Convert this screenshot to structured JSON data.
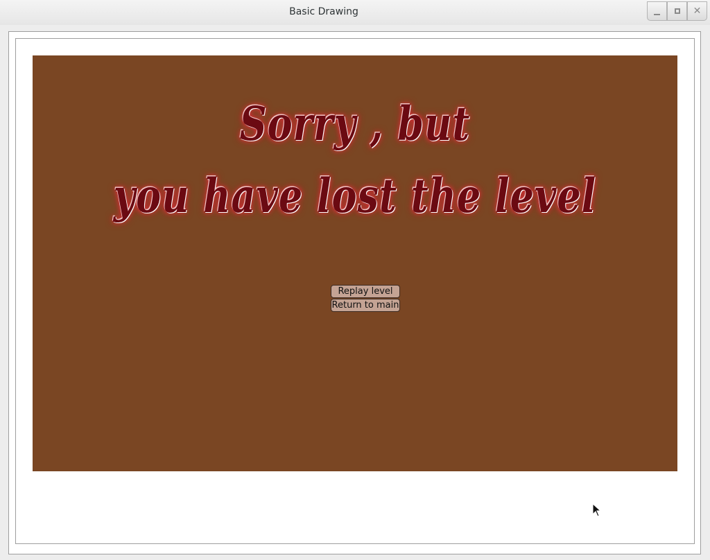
{
  "window": {
    "title": "Basic Drawing",
    "controls": [
      "minimize",
      "maximize",
      "close"
    ]
  },
  "game": {
    "message_line1": "Sorry , but",
    "message_line2": "you have lost the level",
    "buttons": {
      "replay": "Replay level",
      "return_main": "Return to main"
    }
  },
  "colors": {
    "canvas_bg": "#7a4623",
    "text": "#6b0a12",
    "glow": "#e2383f",
    "button_bg": "#c4a394"
  }
}
